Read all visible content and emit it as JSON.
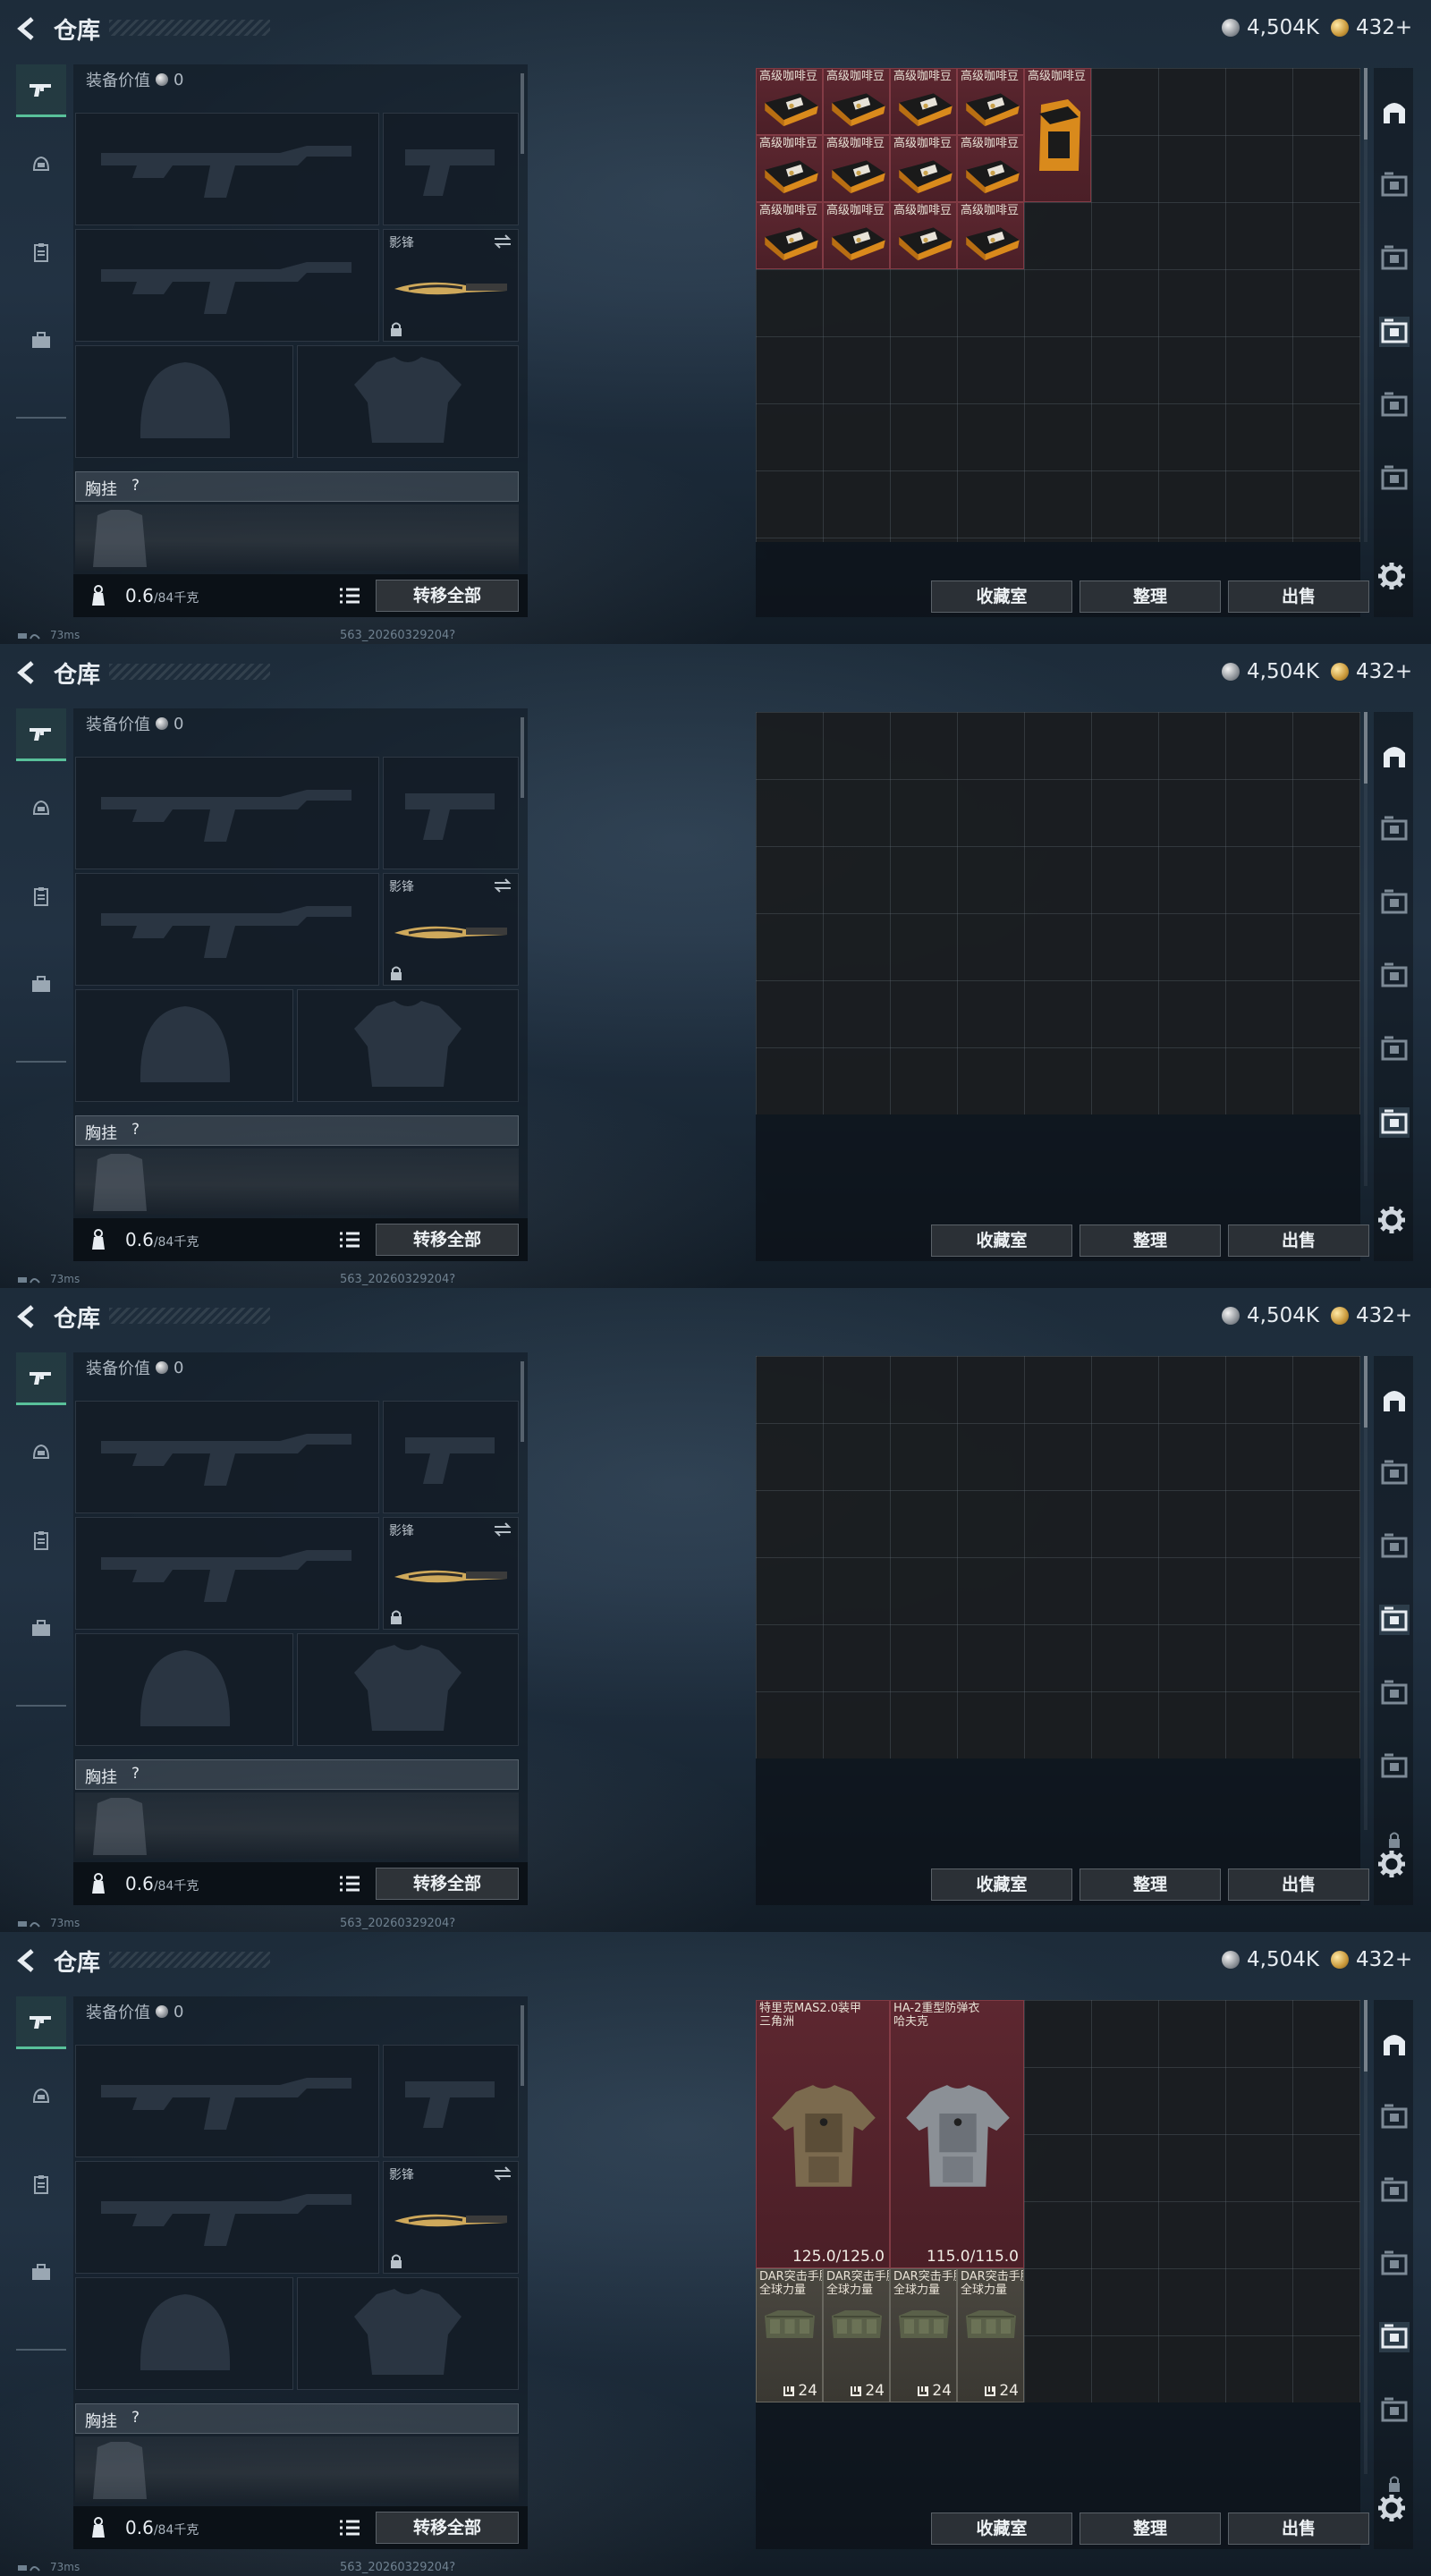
{
  "screens": [
    {
      "header": {
        "title": "仓库",
        "silver": "4,504K",
        "gold": "432+"
      },
      "equipment": {
        "value_label": "装备价值",
        "value": "0",
        "melee_name": "影锋",
        "chest_label": "胸挂",
        "chest_q": "?",
        "weight": "0.6",
        "weight_max": "/84千克",
        "transfer_button": "转移全部"
      },
      "stash": {
        "collection_button": "收藏室",
        "sort_button": "整理",
        "sell_button": "出售",
        "items": [
          "高级咖啡豆",
          "高级咖啡豆",
          "高级咖啡豆",
          "高级咖啡豆",
          "高级咖啡豆",
          "高级咖啡豆",
          "高级咖啡豆",
          "高级咖啡豆",
          "高级咖啡豆",
          "高级咖啡豆",
          "高级咖啡豆",
          "高级咖啡豆",
          "高级咖啡豆"
        ]
      },
      "status": {
        "ping": "73ms",
        "build": "563_20260329204?"
      }
    },
    {
      "header": {
        "title": "仓库",
        "silver": "4,504K",
        "gold": "432+"
      },
      "equipment": {
        "value_label": "装备价值",
        "value": "0",
        "melee_name": "影锋",
        "chest_label": "胸挂",
        "chest_q": "?",
        "weight": "0.6",
        "weight_max": "/84千克",
        "transfer_button": "转移全部"
      },
      "stash": {
        "collection_button": "收藏室",
        "sort_button": "整理",
        "sell_button": "出售"
      },
      "status": {
        "ping": "73ms",
        "build": "563_20260329204?"
      }
    },
    {
      "header": {
        "title": "仓库",
        "silver": "4,504K",
        "gold": "432+"
      },
      "equipment": {
        "value_label": "装备价值",
        "value": "0",
        "melee_name": "影锋",
        "chest_label": "胸挂",
        "chest_q": "?",
        "weight": "0.6",
        "weight_max": "/84千克",
        "transfer_button": "转移全部"
      },
      "stash": {
        "collection_button": "收藏室",
        "sort_button": "整理",
        "sell_button": "出售"
      },
      "status": {
        "ping": "73ms",
        "build": "563_20260329204?"
      }
    },
    {
      "header": {
        "title": "仓库",
        "silver": "4,504K",
        "gold": "432+"
      },
      "equipment": {
        "value_label": "装备价值",
        "value": "0",
        "melee_name": "影锋",
        "chest_label": "胸挂",
        "chest_q": "?",
        "weight": "0.6",
        "weight_max": "/84千克",
        "transfer_button": "转移全部"
      },
      "stash": {
        "collection_button": "收藏室",
        "sort_button": "整理",
        "sell_button": "出售",
        "armor1": {
          "name": "特里克MAS2.0装甲",
          "sub": "三角洲",
          "durability": "125.0/125.0"
        },
        "armor2": {
          "name": "HA-2重型防弹衣",
          "sub": "哈夫克",
          "durability": "115.0/115.0"
        },
        "rigs": [
          {
            "name": "DAR突击手胸挂",
            "sub": "全球力量",
            "count": "24"
          },
          {
            "name": "DAR突击手胸挂",
            "sub": "全球力量",
            "count": "24"
          },
          {
            "name": "DAR突击手胸挂",
            "sub": "全球力量",
            "count": "24"
          },
          {
            "name": "DAR突击手胸挂",
            "sub": "全球力量",
            "count": "24"
          }
        ]
      },
      "status": {
        "ping": "73ms",
        "build": "563_20260329204?"
      }
    }
  ],
  "colors": {
    "accent_green": "#59c09a",
    "rare_red": "#5d2730",
    "item_gray": "#4a4740"
  },
  "icons": {
    "nav": [
      "gun-icon",
      "helmet-icon",
      "clipboard-icon",
      "briefcase-icon"
    ],
    "rail": [
      "arch-icon",
      "case-icon",
      "settings-gear-icon"
    ]
  }
}
